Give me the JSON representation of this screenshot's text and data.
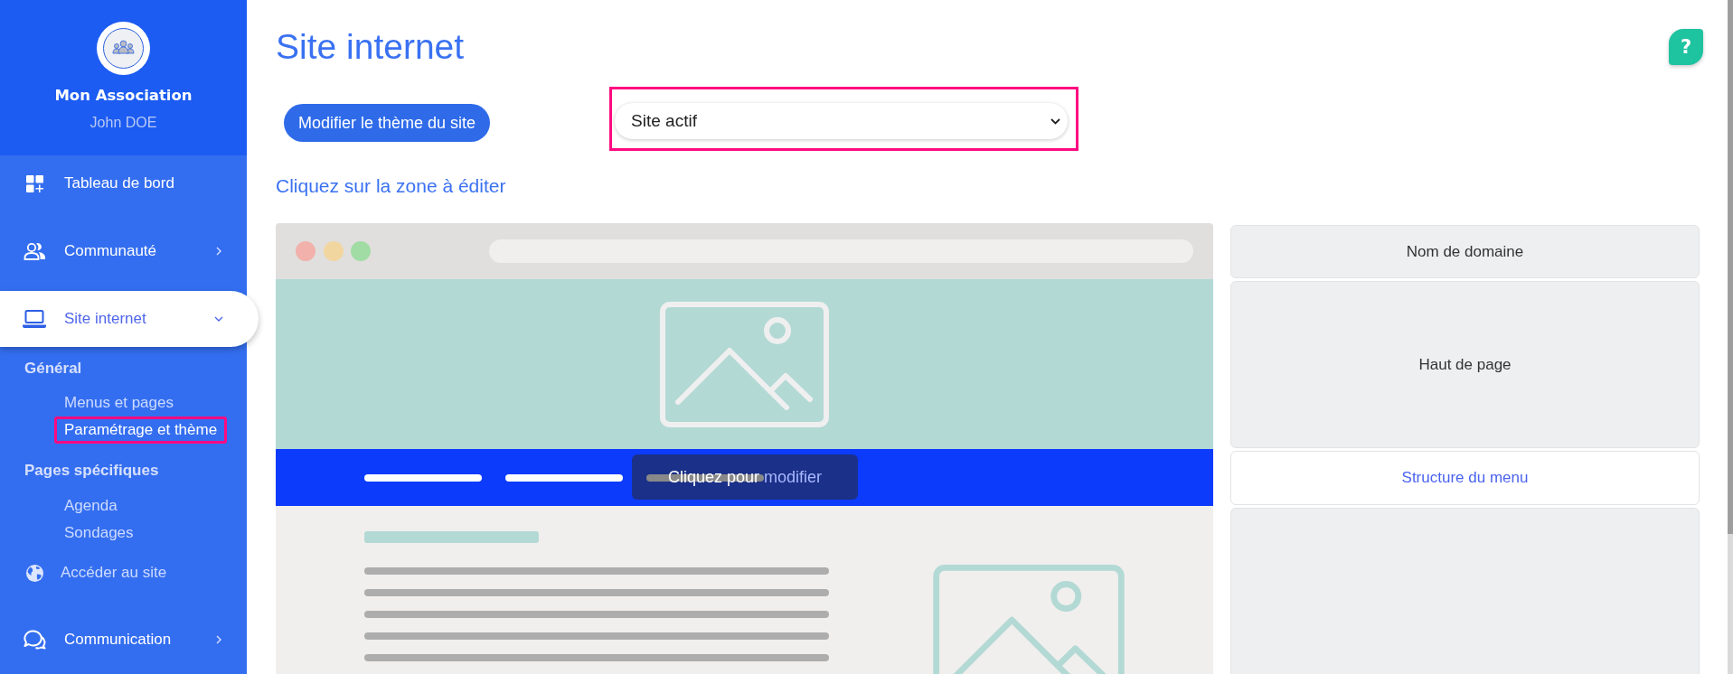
{
  "sidebar": {
    "org_name": "Mon Association",
    "user_name": "John DOE",
    "nav": [
      {
        "kind": "item",
        "label": "Tableau de bord",
        "selected": false
      },
      {
        "kind": "menu",
        "label": "Communauté",
        "selected": false,
        "expanded": false
      },
      {
        "kind": "menu",
        "label": "Site internet",
        "selected": true,
        "expanded": true,
        "groups": [
          {
            "title": "Général",
            "links": [
              {
                "label": "Menus et pages",
                "selected": false,
                "highlighted": false
              },
              {
                "label": "Paramétrage et thème",
                "selected": true,
                "highlighted": true
              }
            ]
          },
          {
            "title": "Pages spécifiques",
            "links": [
              {
                "label": "Agenda",
                "selected": false,
                "highlighted": false
              },
              {
                "label": "Sondages",
                "selected": false,
                "highlighted": false
              }
            ]
          }
        ]
      },
      {
        "kind": "link",
        "label": "Accéder au site",
        "selected": false
      },
      {
        "kind": "menu",
        "label": "Communication",
        "selected": false,
        "expanded": false
      }
    ]
  },
  "header": {
    "title": "Site internet",
    "help_button": "?"
  },
  "toolbar": {
    "theme_button": "Modifier le thème du site",
    "status_select": {
      "value": "Site actif",
      "highlighted": true
    }
  },
  "hint": "Cliquez sur la zone à éditer",
  "preview": {
    "tooltip": {
      "text": "Cliquez pour",
      "accent": "modifier"
    }
  },
  "zones": [
    {
      "label": "Nom de domaine",
      "selected": false
    },
    {
      "label": "Haut de page",
      "selected": false
    },
    {
      "label": "Structure du menu",
      "selected": true
    },
    {
      "selected": false
    }
  ]
}
